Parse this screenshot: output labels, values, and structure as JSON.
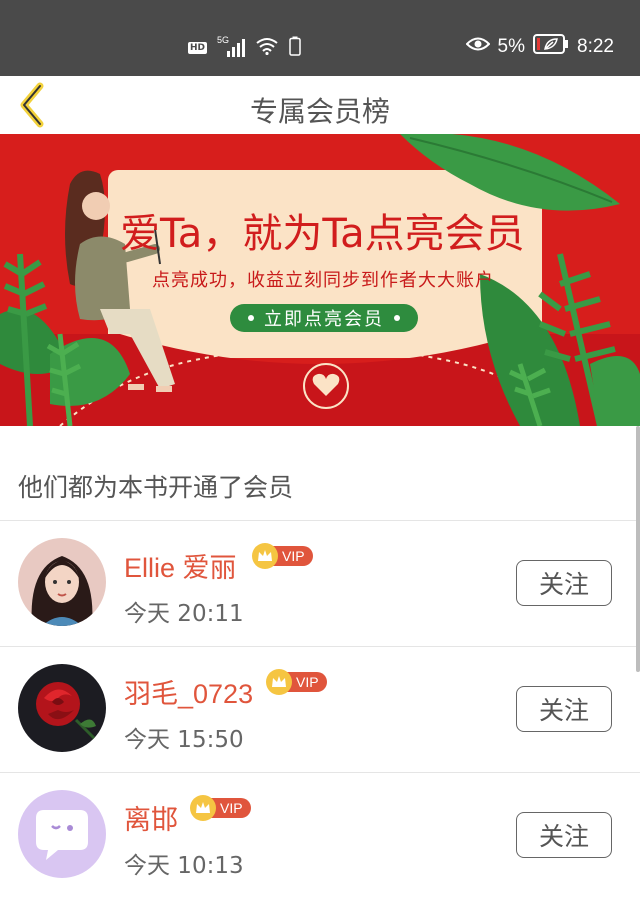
{
  "status_bar": {
    "network_badge": "HD",
    "network_type": "5G",
    "battery_percent": "5%",
    "time": "8:22"
  },
  "header": {
    "title": "专属会员榜"
  },
  "banner": {
    "title": "爱Ta，就为Ta点亮会员",
    "subtitle": "点亮成功，收益立刻同步到作者大大账户",
    "button_label": "立即点亮会员",
    "colors": {
      "background": "#d71e1c",
      "card": "#fbe3c6",
      "button": "#2e8c3e",
      "leaf": "#3a9a45"
    }
  },
  "section": {
    "title": "他们都为本书开通了会员"
  },
  "members": [
    {
      "name": "Ellie 爱丽",
      "badge": "VIP",
      "time": "今天 20:11",
      "follow_label": "关注",
      "avatar": "portrait-photo"
    },
    {
      "name": "羽毛_0723",
      "badge": "VIP",
      "time": "今天 15:50",
      "follow_label": "关注",
      "avatar": "red-rose-photo"
    },
    {
      "name": "离邯",
      "badge": "VIP",
      "time": "今天 10:13",
      "follow_label": "关注",
      "avatar": "default-chat-avatar"
    }
  ]
}
